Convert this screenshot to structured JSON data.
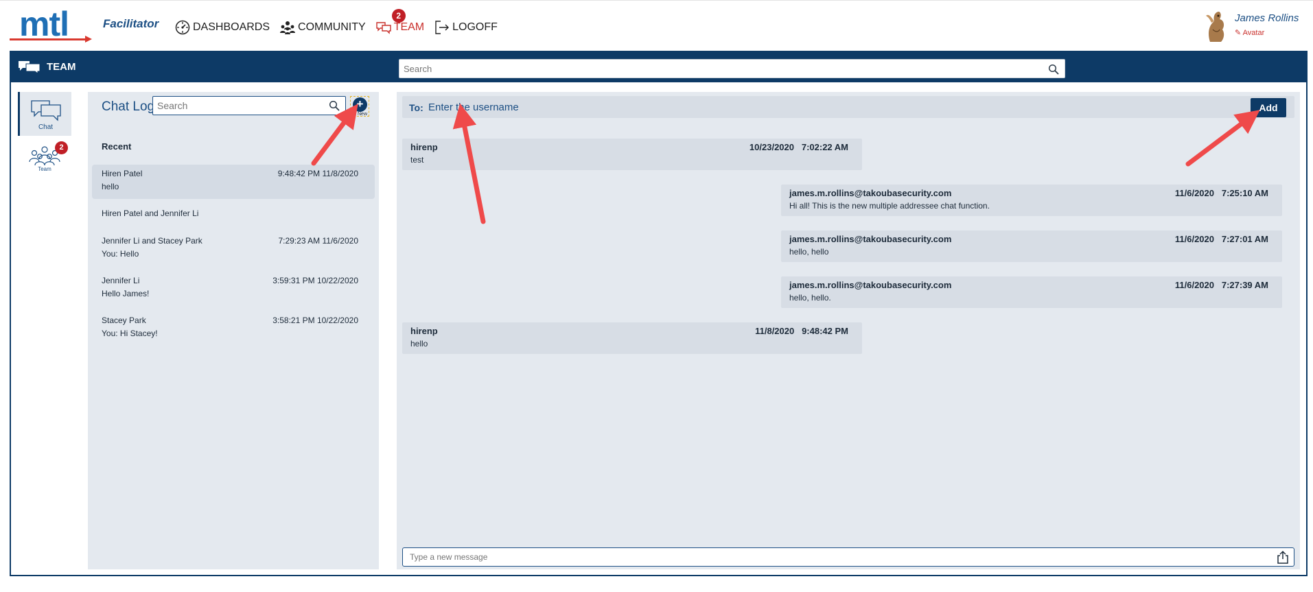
{
  "header": {
    "logo": "mtl",
    "subtitle": "Facilitator",
    "nav": [
      {
        "label": "DASHBOARDS",
        "icon": "dashboard-icon"
      },
      {
        "label": "COMMUNITY",
        "icon": "community-icon"
      },
      {
        "label": "TEAM",
        "icon": "team-chat-icon",
        "badge": "2",
        "active": true
      },
      {
        "label": "LOGOFF",
        "icon": "logoff-icon"
      }
    ],
    "user": {
      "name": "James Rollins",
      "avatar_link": "Avatar"
    }
  },
  "bar": {
    "title": "TEAM",
    "search_placeholder": "Search"
  },
  "rail": {
    "chat_label": "Chat",
    "team_label": "Team",
    "team_badge": "2"
  },
  "chatlog": {
    "title": "Chat Log",
    "search_placeholder": "Search",
    "new_label": "New",
    "recent_label": "Recent",
    "conversations": [
      {
        "name": "Hiren Patel",
        "time": "9:48:42 PM 11/8/2020",
        "preview": "hello"
      },
      {
        "name": "Hiren Patel and Jennifer Li",
        "time": "",
        "preview": ""
      },
      {
        "name": "Jennifer Li and Stacey Park",
        "time": "7:29:23 AM 11/6/2020",
        "preview": "You: Hello"
      },
      {
        "name": "Jennifer Li",
        "time": "3:59:31 PM 10/22/2020",
        "preview": "Hello James!"
      },
      {
        "name": "Stacey Park",
        "time": "3:58:21 PM 10/22/2020",
        "preview": "You: Hi Stacey!"
      }
    ]
  },
  "messages": {
    "to_label": "To:",
    "to_placeholder": "Enter the username",
    "add_label": "Add",
    "items": [
      {
        "sender": "hirenp",
        "date": "10/23/2020",
        "time": "7:02:22 AM",
        "text": "test",
        "side": "left"
      },
      {
        "sender": "james.m.rollins@takoubasecurity.com",
        "date": "11/6/2020",
        "time": "7:25:10 AM",
        "text": "Hi all! This is the new multiple addressee chat function.",
        "side": "right"
      },
      {
        "sender": "james.m.rollins@takoubasecurity.com",
        "date": "11/6/2020",
        "time": "7:27:01 AM",
        "text": "hello, hello",
        "side": "right"
      },
      {
        "sender": "james.m.rollins@takoubasecurity.com",
        "date": "11/6/2020",
        "time": "7:27:39 AM",
        "text": "hello, hello.",
        "side": "right"
      },
      {
        "sender": "hirenp",
        "date": "11/8/2020",
        "time": "9:48:42 PM",
        "text": "hello",
        "side": "left"
      }
    ],
    "compose_placeholder": "Type a new message"
  },
  "colors": {
    "brand_navy": "#0d3a66",
    "accent_red": "#c9302c",
    "panel_bg": "#e4e9ef",
    "annotation_arrow": "#ef4a4a"
  }
}
